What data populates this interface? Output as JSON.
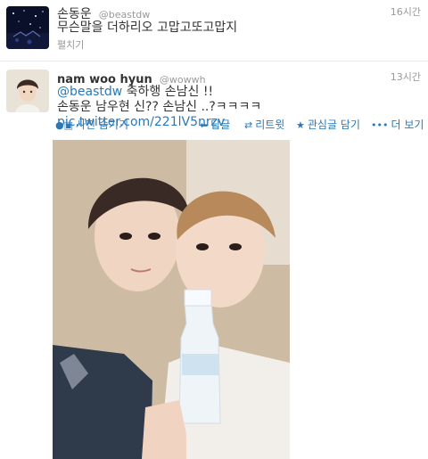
{
  "tweets": [
    {
      "name": "손동운",
      "handle": "@beastdw",
      "time": "16시간",
      "text": "무슨말을 더하리오 고맙고또고맙지",
      "expand": "펼치기"
    },
    {
      "name": "nam woo hyun",
      "handle": "@wowwh",
      "time": "13시간",
      "mention": "@beastdw",
      "line1_rest": " 축하행 손남신 !!",
      "line2_text": "손동운 남우현 신?? 손남신 ..?ㅋㅋㅋㅋ ",
      "link": "pic.twitter.com/221lV5nrzv",
      "actions": {
        "photo_label": "사진 숨기기",
        "reply_label": "답글",
        "retweet_label": "리트윗",
        "favorite_label": "관심글 담기",
        "more_label": "더 보기"
      }
    }
  ],
  "colors": {
    "link": "#2a78b8",
    "muted": "#999999",
    "text": "#333333"
  },
  "icons": [
    "camera-icon",
    "reply-icon",
    "retweet-icon",
    "star-icon",
    "more-icon"
  ]
}
